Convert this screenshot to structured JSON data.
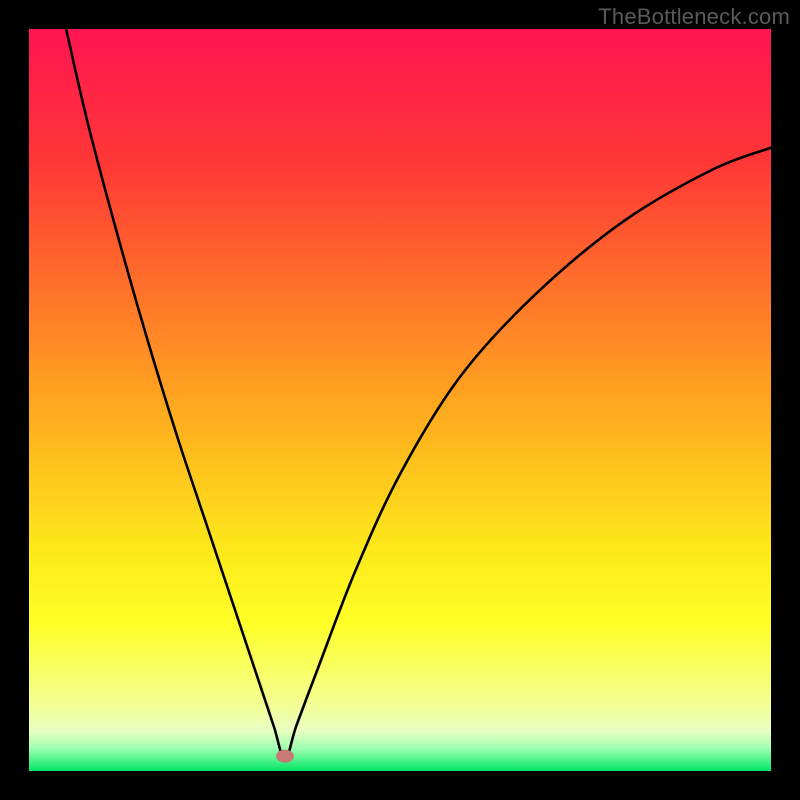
{
  "watermark": "TheBottleneck.com",
  "chart_data": {
    "type": "line",
    "title": "",
    "xlabel": "",
    "ylabel": "",
    "xlim": [
      0,
      100
    ],
    "ylim": [
      0,
      100
    ],
    "background_gradient_stops": [
      {
        "offset": 0,
        "color": "#ff1552"
      },
      {
        "offset": 0.18,
        "color": "#ff3736"
      },
      {
        "offset": 0.5,
        "color": "#ffa51f"
      },
      {
        "offset": 0.7,
        "color": "#fde81a"
      },
      {
        "offset": 0.8,
        "color": "#ffff26"
      },
      {
        "offset": 0.9,
        "color": "#f5ff88"
      },
      {
        "offset": 0.945,
        "color": "#eaffc0"
      },
      {
        "offset": 0.97,
        "color": "#9cffb0"
      },
      {
        "offset": 1.0,
        "color": "#00e663"
      }
    ],
    "marker": {
      "x": 34.5,
      "y": 2.0,
      "color": "#c77a74"
    },
    "series": [
      {
        "name": "curve",
        "x": [
          5,
          8,
          12,
          16,
          20,
          24,
          28,
          31,
          33,
          34.5,
          36,
          39,
          44,
          50,
          58,
          68,
          80,
          92,
          100
        ],
        "y": [
          100,
          87,
          72,
          58,
          45,
          33,
          21,
          12,
          6,
          1.5,
          6,
          14,
          27,
          40,
          53,
          64,
          74,
          81,
          84
        ]
      }
    ]
  }
}
